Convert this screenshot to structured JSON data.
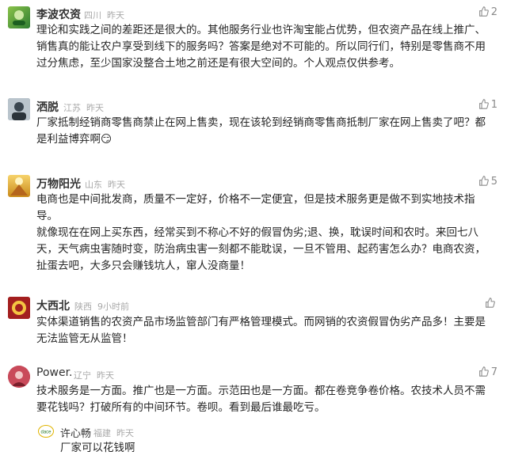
{
  "comments": [
    {
      "user": "李波农资",
      "location": "四川",
      "time": "昨天",
      "likes": "2",
      "lines": [
        "理论和实践之间的差距还是很大的。其他服务行业也许淘宝能占优势，但农资产品在线上推广、",
        "销售真的能让农户享受到线下的服务吗？答案是绝对不可能的。所以同行们，特别是零售商不用",
        "过分焦虑，至少国家没整合土地之前还是有很大空间的。个人观点仅供参考。"
      ]
    },
    {
      "user": "洒脱",
      "location": "江苏",
      "time": "昨天",
      "likes": "1",
      "lines": [
        "厂家抵制经销商零售商禁止在网上售卖，现在该轮到经销商零售商抵制厂家在网上售卖了吧？都",
        "是利益博弈啊😏"
      ]
    },
    {
      "user": "万物阳光",
      "location": "山东",
      "time": "昨天",
      "likes": "5",
      "lines": [
        "电商也是中间批发商，质量不一定好，价格不一定便宜，但是技术服务更是做不到实地技术指",
        "导。",
        "就像现在在网上买东西，经常买到不称心不好的假冒伪劣;退、换，耽误时间和农时。来回七八",
        "天，天气病虫害随时变，防治病虫害一刻都不能耽误，一旦不管用、起药害怎么办？电商农资，",
        "扯蛋去吧，大多只会赚钱坑人，窜人没商量！"
      ]
    },
    {
      "user": "大西北",
      "location": "陕西",
      "time": "9小时前",
      "likes": "",
      "lines": [
        "实体渠道销售的农资产品市场监管部门有严格管理模式。而网销的农资假冒伪劣产品多！主要是",
        "无法监管无从监管！"
      ]
    },
    {
      "user": "Power.",
      "location": "辽宁",
      "time": "昨天",
      "likes": "7",
      "lines": [
        "技术服务是一方面。推广也是一方面。示范田也是一方面。都在卷竞争卷价格。农技术人员不需",
        "要花钱吗？打破所有的中间环节。卷呗。看到最后谁最吃亏。"
      ],
      "reply": {
        "logo_text": "dace",
        "user": "许心畅",
        "location": "福建",
        "time": "昨天",
        "lines": [
          "厂家可以花钱啊"
        ]
      }
    }
  ],
  "colors": {
    "meta": "#a8a8a8",
    "text": "#262626",
    "like": "#8a8a8a"
  }
}
